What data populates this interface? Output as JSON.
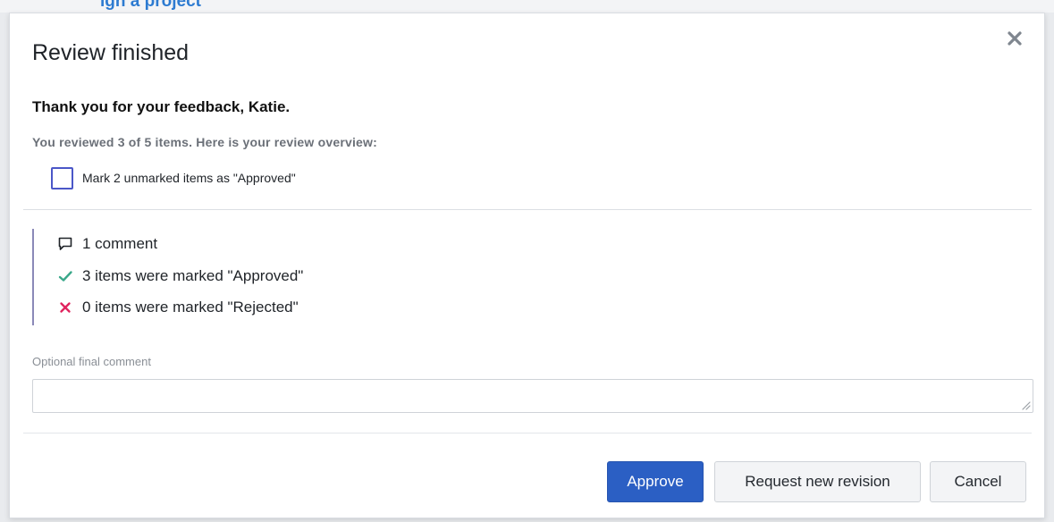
{
  "background": {
    "partial_link_text": "ign a project"
  },
  "dialog": {
    "title": "Review finished",
    "close_glyph": "✕",
    "greeting": "Thank you for your feedback, Katie.",
    "overview_text": "You reviewed 3 of 5 items. Here is your review overview:",
    "mark_unmarked_label": "Mark 2 unmarked items as \"Approved\"",
    "mark_unmarked_checked": false,
    "summary": {
      "comments": "1 comment",
      "approved": "3 items were marked \"Approved\"",
      "rejected": "0 items were marked \"Rejected\""
    },
    "final_comment_label": "Optional final comment",
    "final_comment_value": "",
    "buttons": {
      "approve": "Approve",
      "request_revision": "Request new revision",
      "cancel": "Cancel"
    }
  },
  "icons": {
    "close": "close-icon",
    "comment": "comment-icon",
    "approved": "checkmark-icon",
    "rejected": "cross-icon",
    "resize": "resize-grip-icon"
  },
  "colors": {
    "primary": "#2b5fc4",
    "checkbox_border": "#4b57c8",
    "approved": "#3aa88a",
    "rejected": "#e0245e",
    "summary_bar": "#8b89b8"
  }
}
